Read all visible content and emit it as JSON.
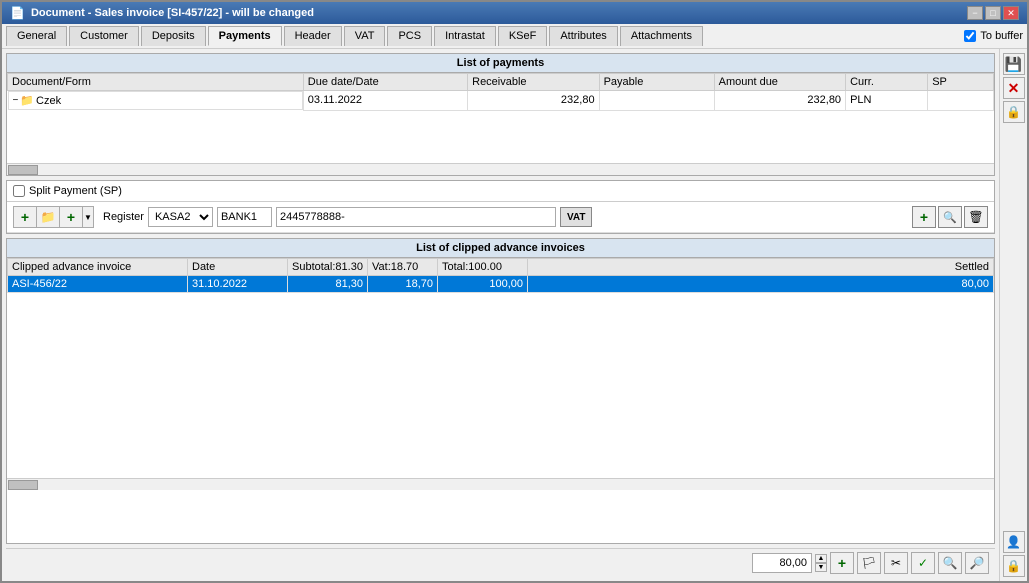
{
  "window": {
    "title": "Document - Sales invoice [SI-457/22]  - will be changed",
    "minimize_label": "−",
    "maximize_label": "□",
    "close_label": "✕"
  },
  "tabs": [
    {
      "label": "General",
      "active": false
    },
    {
      "label": "Customer",
      "active": false
    },
    {
      "label": "Deposits",
      "active": false
    },
    {
      "label": "Payments",
      "active": true
    },
    {
      "label": "Header",
      "active": false
    },
    {
      "label": "VAT",
      "active": false
    },
    {
      "label": "PCS",
      "active": false
    },
    {
      "label": "Intrastat",
      "active": false
    },
    {
      "label": "KSeF",
      "active": false
    },
    {
      "label": "Attributes",
      "active": false
    },
    {
      "label": "Attachments",
      "active": false
    }
  ],
  "to_buffer": {
    "label": "To buffer",
    "checked": true
  },
  "payments_section": {
    "title": "List of payments",
    "columns": [
      "Document/Form",
      "Due date/Date",
      "Receivable",
      "Payable",
      "Amount due",
      "Curr.",
      "SP"
    ],
    "rows": [
      {
        "expand": "−",
        "icon": "📁",
        "form": "Czek",
        "due_date": "03.11.2022",
        "receivable": "232,80",
        "payable": "",
        "amount_due": "232,80",
        "curr": "PLN",
        "sp": ""
      }
    ]
  },
  "split_payment": {
    "label": "Split Payment (SP)",
    "checked": false
  },
  "payment_controls": {
    "register_label": "Register",
    "register_value": "KASA2",
    "bank_value": "BANK1",
    "account_value": "2445778888-",
    "vat_btn": "VAT"
  },
  "advance_section": {
    "title": "List of clipped advance invoices",
    "columns": [
      {
        "label": "Clipped advance invoice"
      },
      {
        "label": "Date"
      },
      {
        "label": "Subtotal:81.30"
      },
      {
        "label": "Vat:18.70"
      },
      {
        "label": "Total:100.00"
      },
      {
        "label": "Settled"
      }
    ],
    "rows": [
      {
        "invoice": "ASI-456/22",
        "date": "31.10.2022",
        "subtotal": "81,30",
        "vat": "18,70",
        "total": "100,00",
        "settled": "80,00",
        "selected": true
      }
    ]
  },
  "bottom": {
    "amount": "80,00",
    "spin_up": "▲",
    "spin_down": "▼"
  },
  "right_toolbar": {
    "save_icon": "💾",
    "delete_icon": "✕",
    "lock_icon": "🔒",
    "person_icon": "👤"
  }
}
